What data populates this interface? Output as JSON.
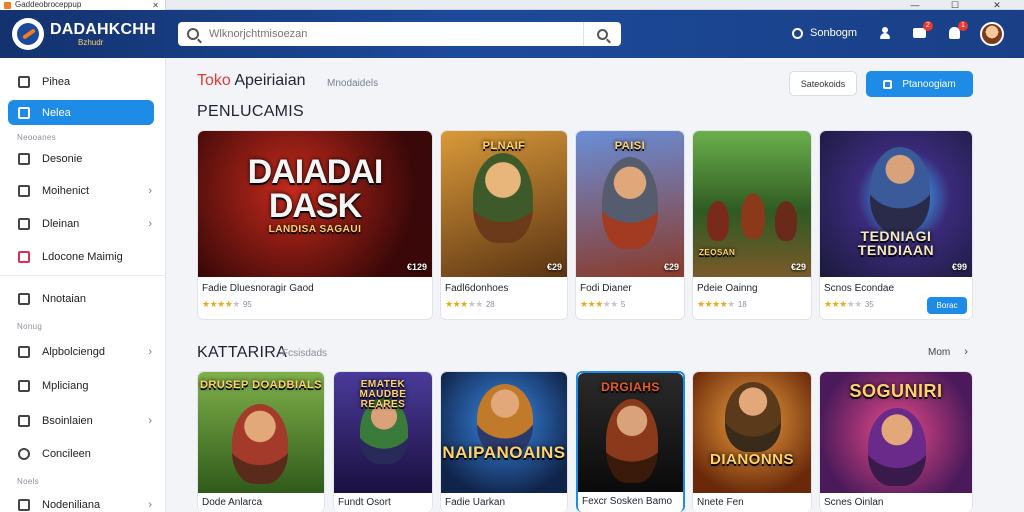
{
  "window": {
    "tab_title": "Gaddeobroceppup",
    "close": "✕",
    "minimize": "—",
    "maximize": "☐",
    "close_window": "✕"
  },
  "header": {
    "brand_name": "DADAHKCHH",
    "brand_tagline": "Bzhudr",
    "search_placeholder": "Wlknorjchtmisoezan",
    "settings_label": "Sonbogm",
    "messages_badge": "2",
    "notifications_badge": "1"
  },
  "sidebar": {
    "items": [
      {
        "label": "Pihea",
        "icon": "home-icon"
      },
      {
        "label": "Nelea",
        "icon": "grid-icon",
        "active": true
      },
      {
        "label": "Desonie",
        "icon": "monitor-icon"
      },
      {
        "label": "Moihenict",
        "icon": "send-icon",
        "chevron": true
      },
      {
        "label": "Dleinan",
        "icon": "folder-icon",
        "chevron": true
      },
      {
        "label": "Ldocone Maimig",
        "icon": "game-icon"
      },
      {
        "label": "Nnotaian",
        "icon": "list-icon"
      },
      {
        "label": "Alpbolciengd",
        "icon": "image-icon",
        "chevron": true
      },
      {
        "label": "Mpliciang",
        "icon": "edit-icon"
      },
      {
        "label": "Bsoinlaien",
        "icon": "folder-icon",
        "chevron": true
      },
      {
        "label": "Concileen",
        "icon": "settings-icon"
      },
      {
        "label": "Nodeniliana",
        "icon": "layers-icon",
        "chevron": true
      }
    ],
    "sections": [
      "Neooanes",
      "Nonug",
      "Noels"
    ]
  },
  "main": {
    "title_red": "Toko",
    "title_rest": "Apeiriaian",
    "subtitle": "Mnodaidels",
    "btn_secondary": "Sateokoids",
    "btn_primary": "Ptanoogiam",
    "section1_title": "PENLUCAMIS",
    "section2_title": "KATTARIRA",
    "section2_sub": "Fcsisdads",
    "more_label": "Mom"
  },
  "featured": [
    {
      "thumb_title": "DAIADAI DASK",
      "thumb_sub": "LANDISA SAGAUI",
      "price": "€129",
      "name": "Fadie Dluesnoragir Gaod",
      "stars": 4,
      "count": "95",
      "bg": "#5a1010"
    },
    {
      "thumb_title": "PLNAIF",
      "price": "€29",
      "name": "Fadl6donhoes",
      "stars": 3,
      "count": "28",
      "bg": "#8b5a22"
    },
    {
      "thumb_title": "PAISI",
      "price": "€29",
      "name": "Fodi Dianer",
      "stars": 3,
      "count": "5",
      "bg": "#3c5fa0"
    },
    {
      "thumb_title": "ZEOSAN",
      "price": "€29",
      "name": "Pdeie Oainng",
      "stars": 4,
      "count": "18",
      "bg": "#3d7a3a"
    },
    {
      "thumb_title": "TEDNIAGI TENDIAAN",
      "price": "€99",
      "name": "Scnos Econdae",
      "stars": 3,
      "count": "35",
      "bg": "#2b2f6b",
      "button": "Borac"
    }
  ],
  "catalog": [
    {
      "thumb_title": "DRUSEP DOADBIALS",
      "name": "Dode Anlarca",
      "bg": "#4b7a2a"
    },
    {
      "thumb_title": "EMATEK MAUDBE REARES",
      "name": "Fundt Osort",
      "bg": "#3a2a6e"
    },
    {
      "thumb_title": "NAIPANOAINS",
      "name": "Fadie Uarkan",
      "bg": "#1d3f8a"
    },
    {
      "thumb_title": "DRGIAHS",
      "name": "Fexcr Sosken Bamo",
      "bg": "#1a1a1a"
    },
    {
      "thumb_title": "DIANONNS",
      "name": "Nnete Fen",
      "bg": "#7a3a12"
    },
    {
      "thumb_title": "SOGUNIRI",
      "name": "Scnes Oinlan",
      "bg": "#6a1f6e"
    }
  ]
}
